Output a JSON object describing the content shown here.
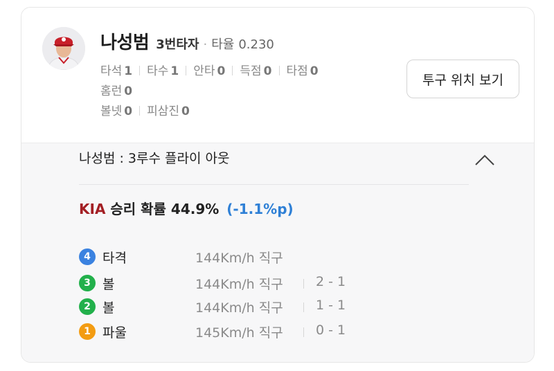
{
  "player": {
    "name": "나성범",
    "batting_order": "3번타자",
    "avg_label": "타율",
    "avg_value": "0.230"
  },
  "stats": [
    {
      "label": "타석",
      "value": "1"
    },
    {
      "label": "타수",
      "value": "1"
    },
    {
      "label": "안타",
      "value": "0"
    },
    {
      "label": "득점",
      "value": "0"
    },
    {
      "label": "타점",
      "value": "0"
    },
    {
      "label": "홈런",
      "value": "0"
    },
    {
      "label": "볼넷",
      "value": "0"
    },
    {
      "label": "피삼진",
      "value": "0"
    }
  ],
  "buttons": {
    "pitch_location": "투구 위치 보기"
  },
  "play": {
    "result": "나성범 : 3루수 플라이 아웃"
  },
  "win_probability": {
    "team": "KIA",
    "label": "승리 확률 44.9%",
    "delta": "(-1.1%p)"
  },
  "pitches": [
    {
      "num": "4",
      "type": "타격",
      "speed": "144Km/h",
      "pitch": "직구",
      "count": "",
      "color": "#3b82e0"
    },
    {
      "num": "3",
      "type": "볼",
      "speed": "144Km/h",
      "pitch": "직구",
      "count": "2 - 1",
      "color": "#22b04b"
    },
    {
      "num": "2",
      "type": "볼",
      "speed": "144Km/h",
      "pitch": "직구",
      "count": "1 - 1",
      "color": "#22b04b"
    },
    {
      "num": "1",
      "type": "파울",
      "speed": "145Km/h",
      "pitch": "직구",
      "count": "0 - 1",
      "color": "#f39c12"
    }
  ],
  "colors": {
    "team_red": "#a31f24",
    "delta_blue": "#2f80d6"
  }
}
